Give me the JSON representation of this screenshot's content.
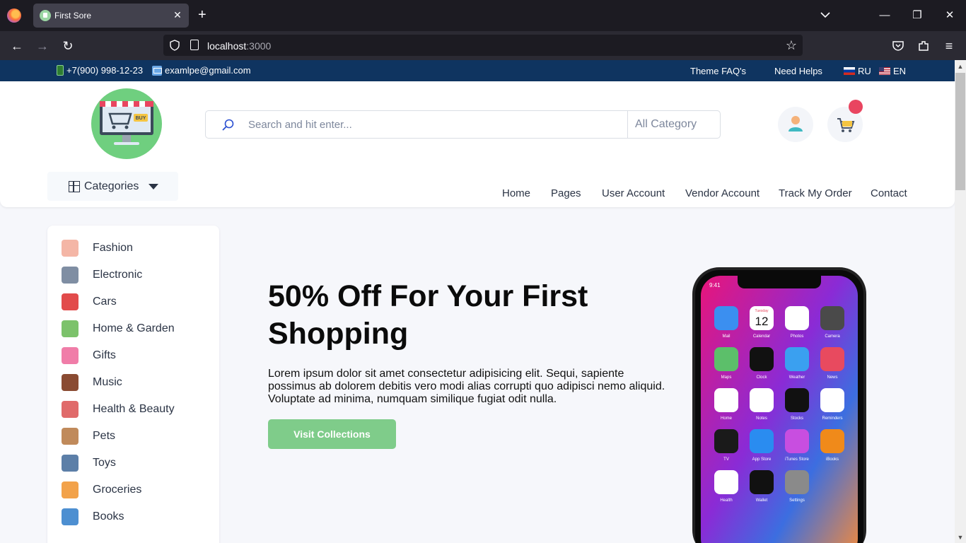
{
  "browser": {
    "tab_title": "First Sore",
    "url_host": "localhost",
    "url_port": ":3000",
    "new_tab": "+",
    "tab_close": "✕",
    "back": "←",
    "forward": "→",
    "reload": "↻",
    "bookmark": "☆",
    "menu": "≡",
    "minimize": "—",
    "restore": "❐",
    "close": "✕"
  },
  "topbar": {
    "phone": "+7(900) 998-12-23",
    "email": "examlpe@gmail.com",
    "faq": "Theme FAQ's",
    "help": "Need Helps",
    "lang_ru": "RU",
    "lang_en": "EN"
  },
  "header": {
    "search_placeholder": "Search and hit enter...",
    "category_select": "All Category",
    "categories_label": "Categories",
    "logo_text": "BUY"
  },
  "nav": [
    "Home",
    "Pages",
    "User Account",
    "Vendor Account",
    "Track My Order",
    "Contact"
  ],
  "sidebar": [
    {
      "label": "Fashion",
      "icon": "fashion-icon",
      "color": "#f4b6a6"
    },
    {
      "label": "Electronic",
      "icon": "electronic-icon",
      "color": "#7f8ea3"
    },
    {
      "label": "Cars",
      "icon": "car-icon",
      "color": "#e24b4b"
    },
    {
      "label": "Home & Garden",
      "icon": "home-garden-icon",
      "color": "#7cc26b"
    },
    {
      "label": "Gifts",
      "icon": "gift-icon",
      "color": "#f07da8"
    },
    {
      "label": "Music",
      "icon": "music-icon",
      "color": "#8a4b32"
    },
    {
      "label": "Health & Beauty",
      "icon": "health-beauty-icon",
      "color": "#e06a6a"
    },
    {
      "label": "Pets",
      "icon": "pets-icon",
      "color": "#c08a5b"
    },
    {
      "label": "Toys",
      "icon": "toys-icon",
      "color": "#5c7fa8"
    },
    {
      "label": "Groceries",
      "icon": "groceries-icon",
      "color": "#f2a24a"
    },
    {
      "label": "Books",
      "icon": "books-icon",
      "color": "#4d8fd1"
    }
  ],
  "hero": {
    "title": "50% Off For Your First Shopping",
    "text": "Lorem ipsum dolor sit amet consectetur adipisicing elit. Sequi, sapiente possimus ab dolorem debitis vero modi alias corrupti quo adipisci nemo aliquid. Voluptate ad minima, numquam similique fugiat odit nulla.",
    "button": "Visit Collections"
  },
  "phone_screen": {
    "time": "9:41",
    "calendar_day": "Tuesday",
    "calendar_date": "12",
    "apps": [
      "Mail",
      "Calendar",
      "Photos",
      "Camera",
      "Maps",
      "Clock",
      "Weather",
      "News",
      "Home",
      "Notes",
      "Stocks",
      "Reminders",
      "TV",
      "App Store",
      "iTunes Store",
      "iBooks",
      "Health",
      "Wallet",
      "Settings"
    ]
  },
  "colors": {
    "topbar": "#0f3460",
    "accent": "#e94560",
    "button": "#7fcc8a",
    "logo": "#6fcf7f"
  }
}
